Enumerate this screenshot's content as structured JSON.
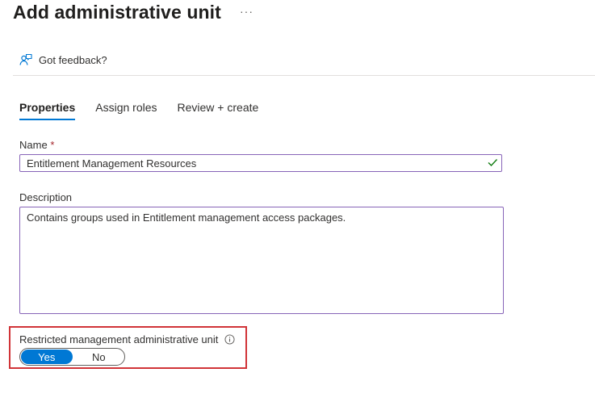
{
  "page": {
    "title": "Add administrative unit",
    "more": "···"
  },
  "toolbar": {
    "feedback_label": "Got feedback?"
  },
  "tabs": [
    {
      "label": "Properties",
      "active": true
    },
    {
      "label": "Assign roles",
      "active": false
    },
    {
      "label": "Review + create",
      "active": false
    }
  ],
  "form": {
    "name_label": "Name",
    "required_mark": "*",
    "name_value": "Entitlement Management Resources",
    "description_label": "Description",
    "description_value": "Contains groups used in Entitlement management access packages.",
    "restricted_label": "Restricted management administrative unit",
    "toggle": {
      "yes": "Yes",
      "no": "No",
      "selected": "Yes"
    }
  },
  "colors": {
    "accent": "#0078d4",
    "field_border": "#8764b8",
    "highlight": "#d13438",
    "valid": "#107c10"
  }
}
